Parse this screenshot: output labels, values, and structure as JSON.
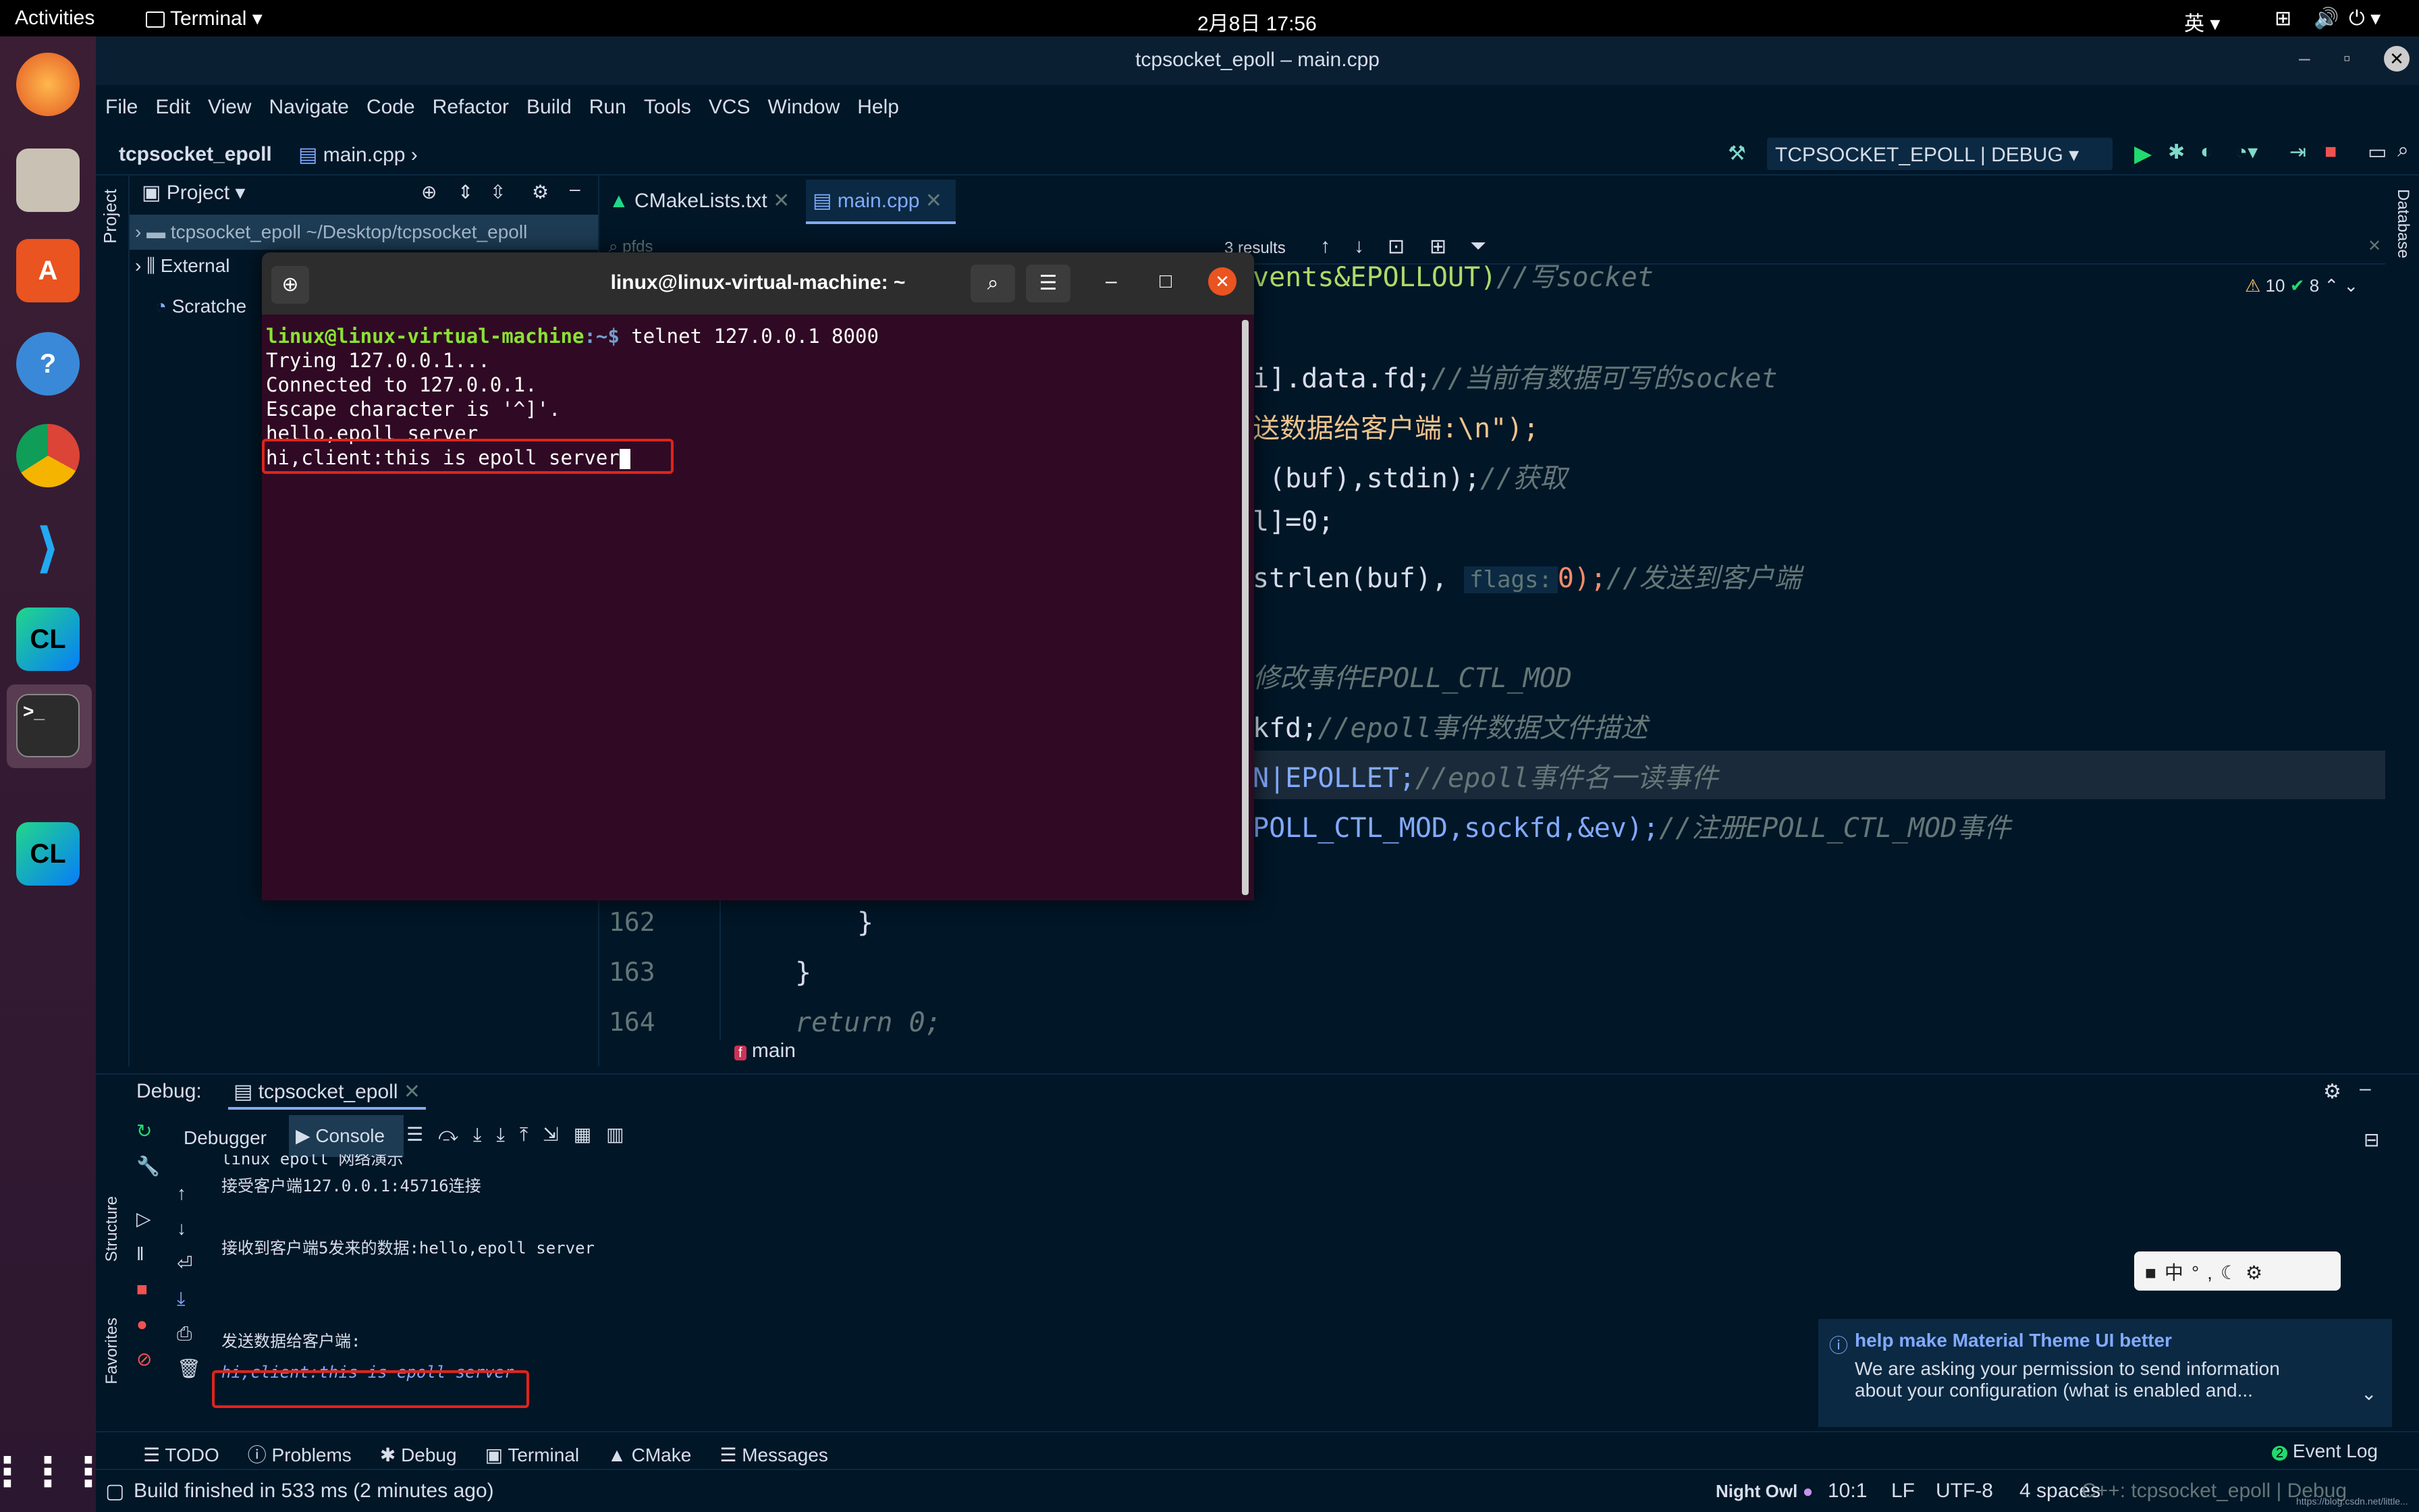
{
  "topbar": {
    "activities": "Activities",
    "app": "Terminal",
    "clock": "2月8日  17:56",
    "ime": "英"
  },
  "window": {
    "title": "tcpsocket_epoll – main.cpp"
  },
  "menu": [
    "File",
    "Edit",
    "View",
    "Navigate",
    "Code",
    "Refactor",
    "Build",
    "Run",
    "Tools",
    "VCS",
    "Window",
    "Help"
  ],
  "nav": {
    "project": "tcpsocket_epoll",
    "file": "main.cpp",
    "run_config": "TCPSOCKET_EPOLL | DEBUG"
  },
  "project_panel": {
    "title": "Project",
    "root": "tcpsocket_epoll  ~/Desktop/tcpsocket_epoll",
    "external": "External",
    "scratches": "Scratche",
    "side_label": "Project"
  },
  "tabs": [
    {
      "label": "CMakeLists.txt"
    },
    {
      "label": "main.cpp"
    }
  ],
  "search": {
    "query": "pfds",
    "results": "3 results"
  },
  "inspections": {
    "warnings": "10",
    "ok": "8"
  },
  "code_lines": [
    {
      "t1": "vents&EPOLLOUT)",
      "t2": "//写socket"
    },
    {
      "t1": "i].data.fd;",
      "t2": "//当前有数据可写的socket"
    },
    {
      "t1": "送数据给客户端:\\n\");"
    },
    {
      "t1": " (buf),stdin);",
      "t2": "//获取"
    },
    {
      "t1": "l]=0;"
    },
    {
      "t1": "strlen(buf),",
      "hint": "flags:",
      "t3": "0);",
      "t2": "//发送到客户端"
    },
    {
      "t2": "修改事件EPOLL_CTL_MOD"
    },
    {
      "t1": "kfd;",
      "t2": "//epoll事件数据文件描述"
    },
    {
      "t1": "N|EPOLLET;",
      "t2": "//epoll事件名一读事件"
    },
    {
      "t1": "POLL_CTL_MOD,sockfd,&ev);",
      "t2": "//注册EPOLL_CTL_MOD事件"
    }
  ],
  "lines": [
    {
      "num": "162",
      "code": "}"
    },
    {
      "num": "163",
      "code": "}"
    },
    {
      "num": "164",
      "code": "return 0;"
    }
  ],
  "breadcrumb_fn": "main",
  "terminal": {
    "title": "linux@linux-virtual-machine: ~",
    "prompt_user": "linux@linux-virtual-machine",
    "prompt_rest": ":~$ ",
    "command": "telnet 127.0.0.1 8000",
    "lines": [
      "Trying 127.0.0.1...",
      "Connected to 127.0.0.1.",
      "Escape character is '^]'.",
      "hello,epoll server",
      "hi,client:this is epoll server"
    ]
  },
  "debug": {
    "label": "Debug:",
    "session": "tcpsocket_epoll",
    "tab_debugger": "Debugger",
    "tab_console": "Console",
    "console": [
      "linux epoll 网络演示",
      "接受客户端127.0.0.1:45716连接",
      "接收到客户端5发来的数据:hello,epoll server",
      "发送数据给客户端:",
      "hi,client:this is epoll server"
    ]
  },
  "ime_toolbar": {
    "chinese": "中",
    "punct": "°,"
  },
  "notification": {
    "title": "help make Material Theme UI better",
    "body1": "We are asking your permission to send information",
    "body2": "about your configuration (what is enabled and..."
  },
  "bottom_tabs": [
    "TODO",
    "Problems",
    "Debug",
    "Terminal",
    "CMake",
    "Messages"
  ],
  "event_log": "Event Log",
  "event_count": "2",
  "side_labels": {
    "structure": "Structure",
    "favorites": "Favorites",
    "database": "Database"
  },
  "status": {
    "message": "Build finished in 533 ms (2 minutes ago)",
    "theme": "Night Owl",
    "pos": "10:1",
    "eol": "LF",
    "enc": "UTF-8",
    "indent": "4 spaces",
    "ctx": "C++: tcpsocket_epoll | Debug",
    "watermark": "https://blog.csdn.net/little..."
  },
  "colors": {
    "accent": "#82aaff",
    "red_box": "#e0241b",
    "terminal_bg": "#300a24",
    "ide_bg": "#011627"
  }
}
